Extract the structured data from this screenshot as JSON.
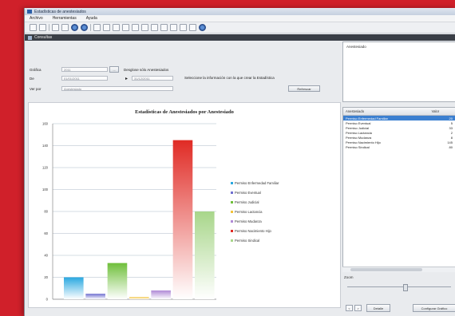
{
  "window": {
    "title": "Estadísticas de anestesiados"
  },
  "menu": [
    "Archivo",
    "Herramientas",
    "Ayuda"
  ],
  "doc_tab": {
    "title": "Consultas"
  },
  "form": {
    "labels": {
      "a": "Gráfica",
      "b": "De",
      "c": "Ver por"
    },
    "field1_value": "2011",
    "field2_value": "01/01/2011",
    "field3_value": "31/12/2011",
    "combo_value": "Anestesiado",
    "cb_label": "Desglose sólo Anestesiados",
    "info_text": "Seleccione la información con la que crear la Estadística",
    "btn_small": "...",
    "btn_refresh": "Refrescar"
  },
  "right": {
    "notes_header": "Anestesiado",
    "grid_headers": [
      "Anestesiado",
      "Valor"
    ],
    "rows": [
      {
        "name": "Permiso Enfermedad Familiar",
        "value": "20",
        "selected": true
      },
      {
        "name": "Permiso Eventual",
        "value": "5",
        "selected": false
      },
      {
        "name": "Permiso Judicial",
        "value": "33",
        "selected": false
      },
      {
        "name": "Permiso Lactancia",
        "value": "2",
        "selected": false
      },
      {
        "name": "Permiso Mudanza",
        "value": "8",
        "selected": false
      },
      {
        "name": "Permiso Nacimiento Hijo",
        "value": "145",
        "selected": false
      },
      {
        "name": "Permiso Sindical",
        "value": "80",
        "selected": false
      }
    ],
    "zoom_label": "Zoom",
    "nav_prev": "<",
    "nav_next": ">",
    "btn_detail": "Detalle",
    "btn_config": "Configurar Gráfico"
  },
  "chart_data": {
    "type": "bar",
    "title": "Estadísticas de Anestesiados por Anestesiado",
    "ylim": [
      0,
      160
    ],
    "yticks": [
      0,
      20,
      40,
      60,
      80,
      100,
      120,
      140,
      160
    ],
    "grid": true,
    "legend_position": "right",
    "series": [
      {
        "name": "Permiso Enfermedad Familiar",
        "value": 20,
        "color": "#2aa8e0"
      },
      {
        "name": "Permiso Eventual",
        "value": 5,
        "color": "#6f6fd0"
      },
      {
        "name": "Permiso Judicial",
        "value": 33,
        "color": "#6fbf3a"
      },
      {
        "name": "Permiso Lactancia",
        "value": 2,
        "color": "#f2c23a"
      },
      {
        "name": "Permiso Mudanza",
        "value": 8,
        "color": "#b08ad6"
      },
      {
        "name": "Permiso Nacimiento Hijo",
        "value": 145,
        "color": "#e02b25"
      },
      {
        "name": "Permiso Sindical",
        "value": 80,
        "color": "#a8d68a"
      }
    ]
  }
}
